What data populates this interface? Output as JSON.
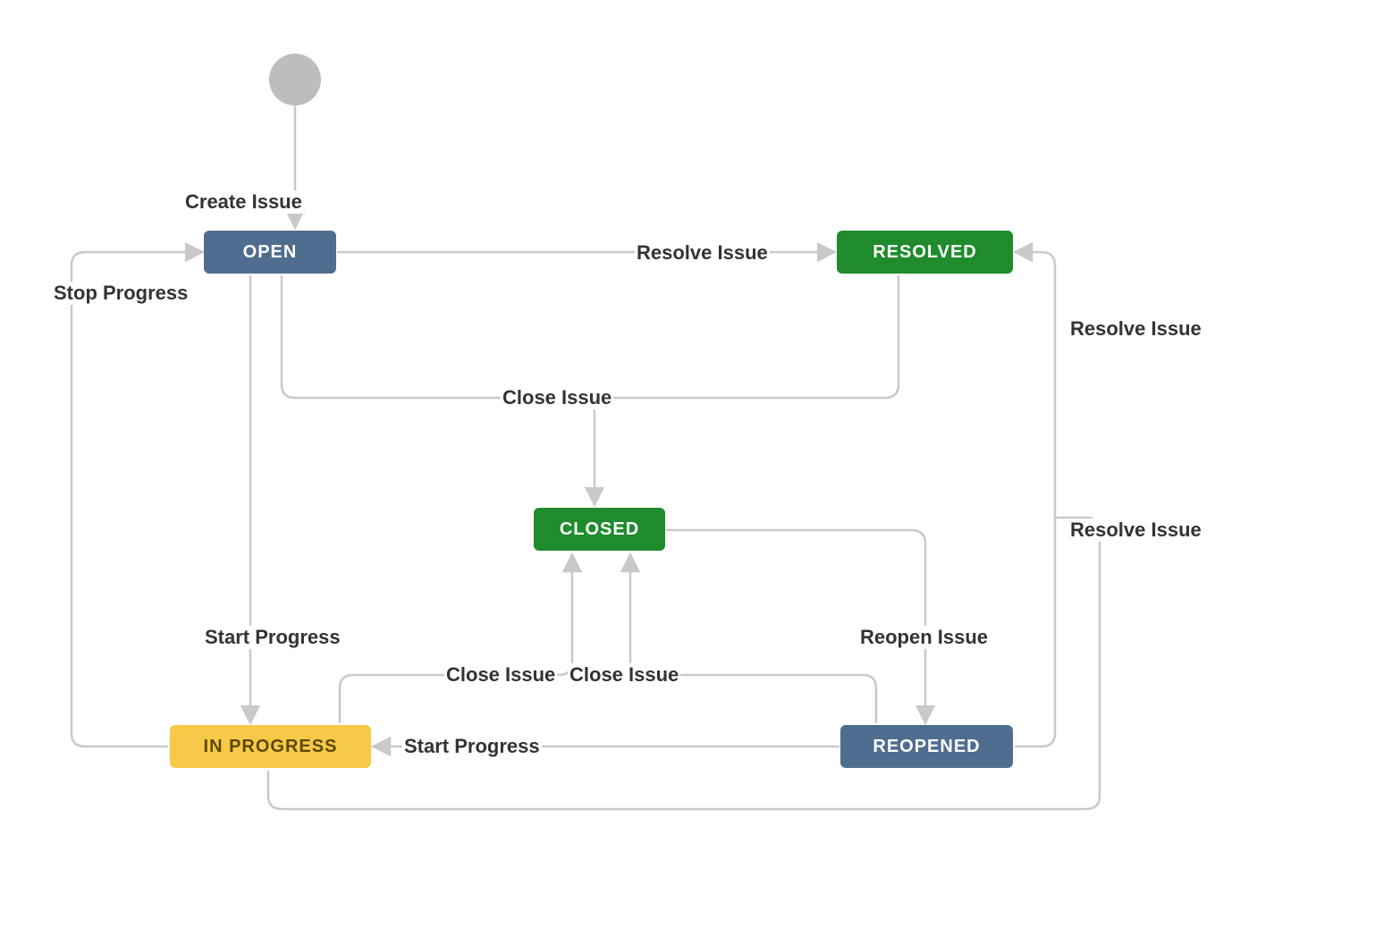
{
  "colors": {
    "blue": "#4f6d8f",
    "green": "#1f8b2c",
    "yellow": "#f7c948",
    "line": "#c9c9c9",
    "text": "#333333",
    "start": "#bdbdbd"
  },
  "states": {
    "open": {
      "label": "OPEN",
      "color": "blue"
    },
    "resolved": {
      "label": "RESOLVED",
      "color": "green"
    },
    "closed": {
      "label": "CLOSED",
      "color": "green"
    },
    "in_progress": {
      "label": "IN PROGRESS",
      "color": "yellow"
    },
    "reopened": {
      "label": "REOPENED",
      "color": "blue"
    }
  },
  "transitions": {
    "create_issue": {
      "label": "Create Issue",
      "from": "start",
      "to": "open"
    },
    "stop_progress": {
      "label": "Stop Progress",
      "from": "in_progress",
      "to": "open"
    },
    "resolve_issue_open": {
      "label": "Resolve Issue",
      "from": "open",
      "to": "resolved"
    },
    "close_issue_open": {
      "label": "Close Issue",
      "from": "open",
      "to": "closed"
    },
    "close_issue_resolved": {
      "label": "Close Issue",
      "from": "resolved",
      "to": "closed"
    },
    "start_progress_open": {
      "label": "Start Progress",
      "from": "open",
      "to": "in_progress"
    },
    "start_progress_reopened": {
      "label": "Start Progress",
      "from": "reopened",
      "to": "in_progress"
    },
    "close_issue_in_progress": {
      "label": "Close Issue",
      "from": "in_progress",
      "to": "closed"
    },
    "close_issue_reopened": {
      "label": "Close Issue",
      "from": "reopened",
      "to": "closed"
    },
    "reopen_issue": {
      "label": "Reopen Issue",
      "from": "closed",
      "to": "reopened"
    },
    "resolve_issue_reopened": {
      "label": "Resolve Issue",
      "from": "reopened",
      "to": "resolved"
    },
    "resolve_issue_inprogress": {
      "label": "Resolve Issue",
      "from": "in_progress",
      "to": "resolved"
    }
  }
}
